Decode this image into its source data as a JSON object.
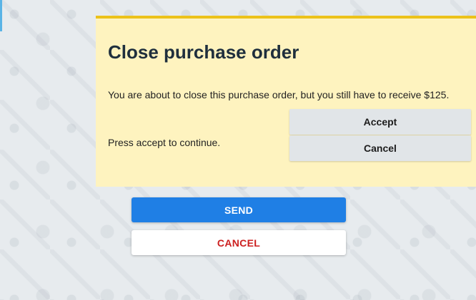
{
  "dialog": {
    "title": "Close purchase order",
    "message": "You are about to close this purchase order, but you still have to receive $125.",
    "hint": "Press accept to continue.",
    "accept_label": "Accept",
    "cancel_label": "Cancel"
  },
  "actions": {
    "send_label": "SEND",
    "cancel_label": "CANCEL"
  },
  "colors": {
    "dialog_background": "#fef3bf",
    "dialog_border": "#ecc21a",
    "send_button": "#1f7fe5",
    "cancel_text": "#cc1f1f"
  }
}
